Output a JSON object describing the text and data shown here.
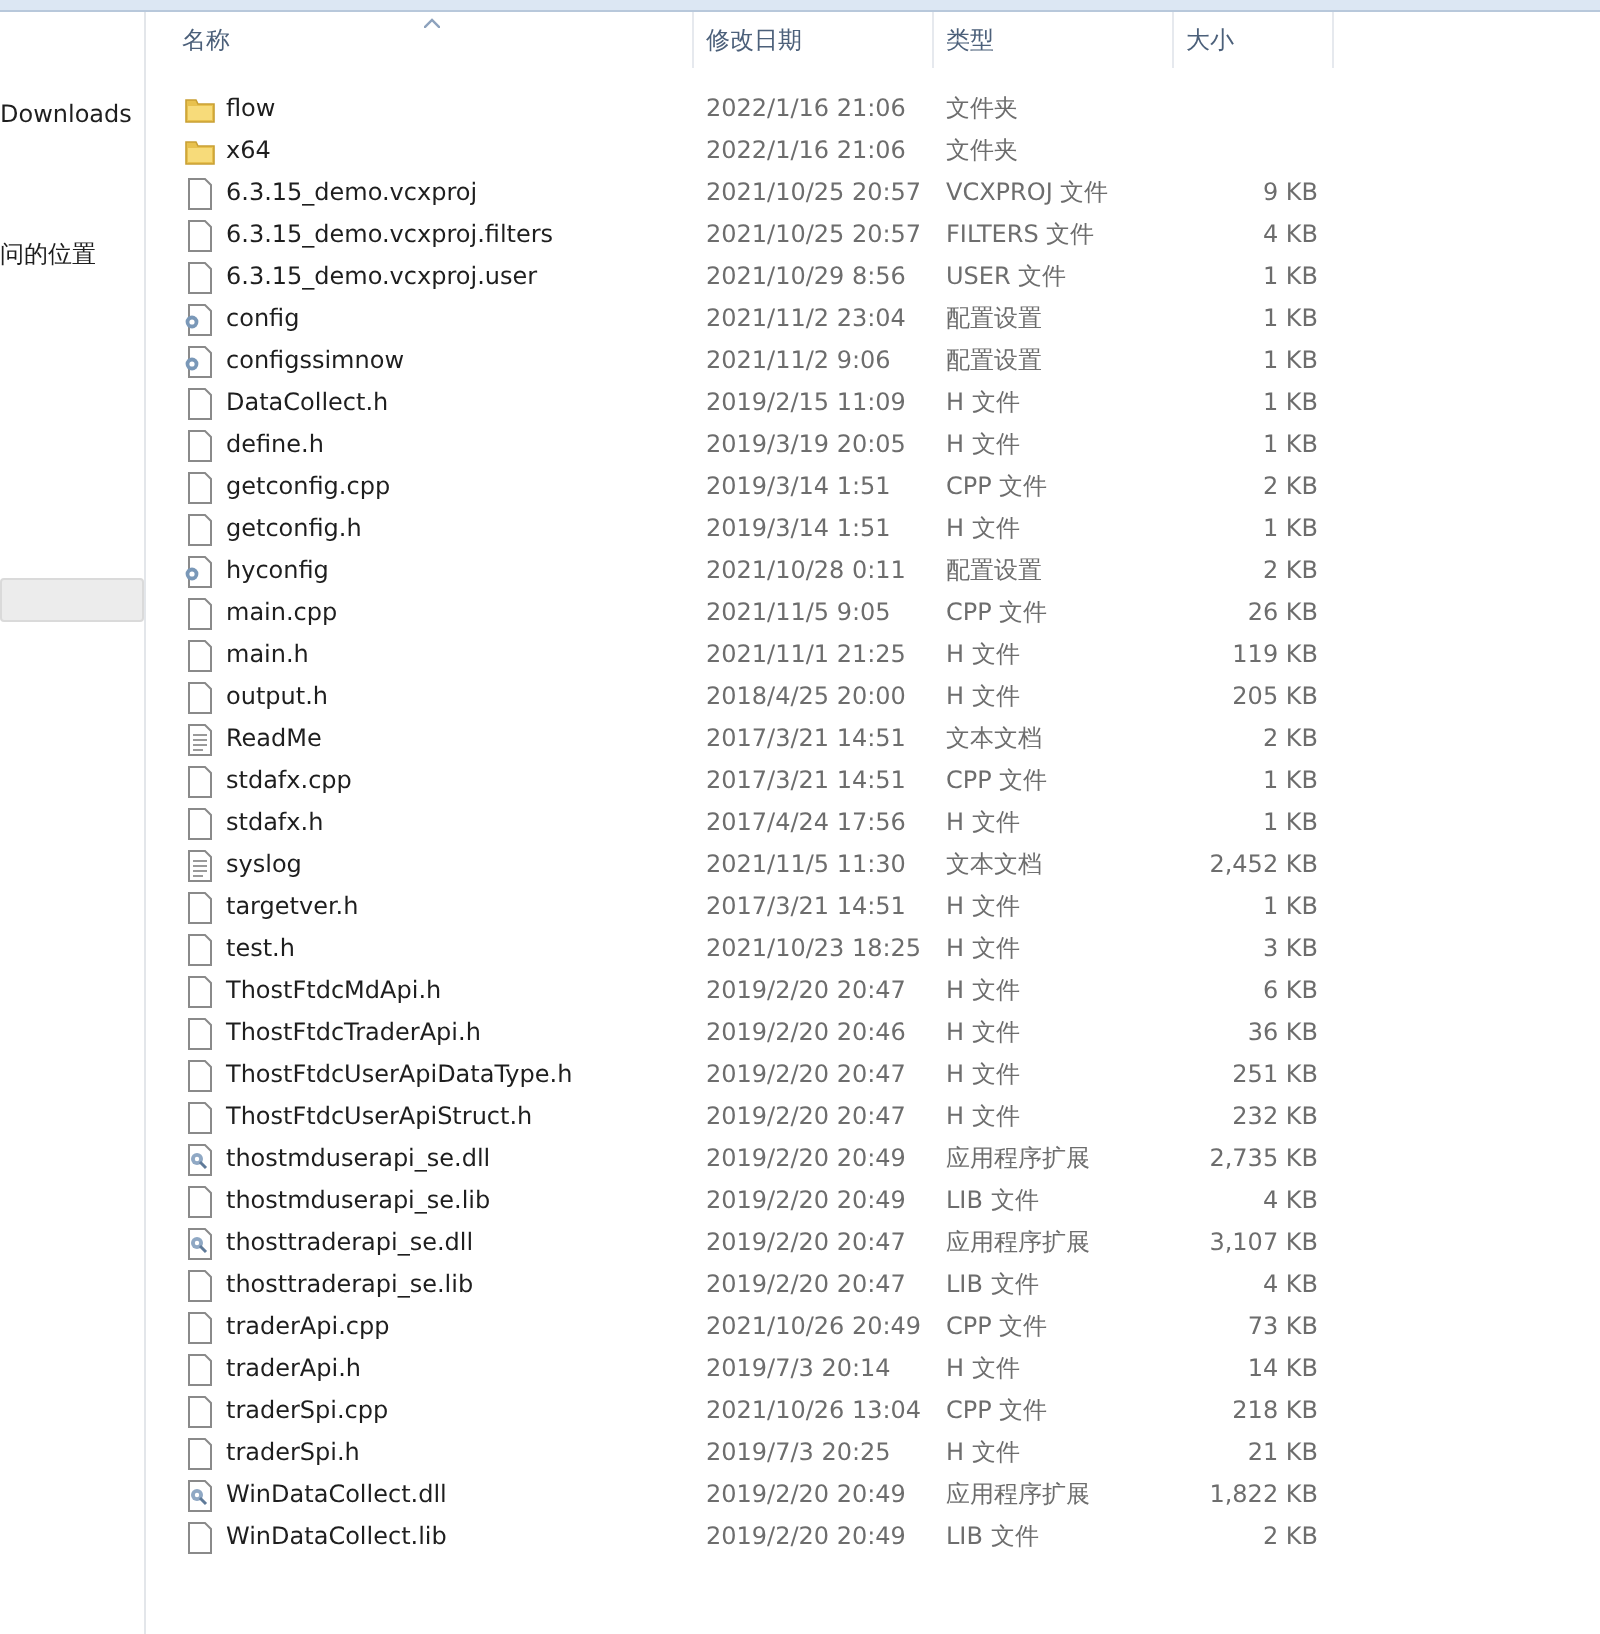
{
  "sidebar": {
    "items": [
      {
        "label": "Downloads",
        "selected": false
      },
      {
        "label": "问的位置",
        "selected": false
      },
      {
        "selected": true
      }
    ]
  },
  "table": {
    "columns": [
      {
        "label": "名称",
        "sorted": true
      },
      {
        "label": "修改日期",
        "sorted": false
      },
      {
        "label": "类型",
        "sorted": false
      },
      {
        "label": "大小",
        "sorted": false
      }
    ],
    "rows": [
      {
        "kind": "folder",
        "name": "flow",
        "date": "2022/1/16 21:06",
        "type": "文件夹",
        "size": ""
      },
      {
        "kind": "folder",
        "name": "x64",
        "date": "2022/1/16 21:06",
        "type": "文件夹",
        "size": ""
      },
      {
        "kind": "file",
        "name": "6.3.15_demo.vcxproj",
        "date": "2021/10/25 20:57",
        "type": "VCXPROJ 文件",
        "size": "9 KB"
      },
      {
        "kind": "file",
        "name": "6.3.15_demo.vcxproj.filters",
        "date": "2021/10/25 20:57",
        "type": "FILTERS 文件",
        "size": "4 KB"
      },
      {
        "kind": "file",
        "name": "6.3.15_demo.vcxproj.user",
        "date": "2021/10/29 8:56",
        "type": "USER 文件",
        "size": "1 KB"
      },
      {
        "kind": "config",
        "name": "config",
        "date": "2021/11/2 23:04",
        "type": "配置设置",
        "size": "1 KB"
      },
      {
        "kind": "config",
        "name": "configssimnow",
        "date": "2021/11/2 9:06",
        "type": "配置设置",
        "size": "1 KB"
      },
      {
        "kind": "file",
        "name": "DataCollect.h",
        "date": "2019/2/15 11:09",
        "type": "H 文件",
        "size": "1 KB"
      },
      {
        "kind": "file",
        "name": "define.h",
        "date": "2019/3/19 20:05",
        "type": "H 文件",
        "size": "1 KB"
      },
      {
        "kind": "file",
        "name": "getconfig.cpp",
        "date": "2019/3/14 1:51",
        "type": "CPP 文件",
        "size": "2 KB"
      },
      {
        "kind": "file",
        "name": "getconfig.h",
        "date": "2019/3/14 1:51",
        "type": "H 文件",
        "size": "1 KB"
      },
      {
        "kind": "config",
        "name": "hyconfig",
        "date": "2021/10/28 0:11",
        "type": "配置设置",
        "size": "2 KB"
      },
      {
        "kind": "file",
        "name": "main.cpp",
        "date": "2021/11/5 9:05",
        "type": "CPP 文件",
        "size": "26 KB"
      },
      {
        "kind": "file",
        "name": "main.h",
        "date": "2021/11/1 21:25",
        "type": "H 文件",
        "size": "119 KB"
      },
      {
        "kind": "file",
        "name": "output.h",
        "date": "2018/4/25 20:00",
        "type": "H 文件",
        "size": "205 KB"
      },
      {
        "kind": "text",
        "name": "ReadMe",
        "date": "2017/3/21 14:51",
        "type": "文本文档",
        "size": "2 KB"
      },
      {
        "kind": "file",
        "name": "stdafx.cpp",
        "date": "2017/3/21 14:51",
        "type": "CPP 文件",
        "size": "1 KB"
      },
      {
        "kind": "file",
        "name": "stdafx.h",
        "date": "2017/4/24 17:56",
        "type": "H 文件",
        "size": "1 KB"
      },
      {
        "kind": "text",
        "name": "syslog",
        "date": "2021/11/5 11:30",
        "type": "文本文档",
        "size": "2,452 KB"
      },
      {
        "kind": "file",
        "name": "targetver.h",
        "date": "2017/3/21 14:51",
        "type": "H 文件",
        "size": "1 KB"
      },
      {
        "kind": "file",
        "name": "test.h",
        "date": "2021/10/23 18:25",
        "type": "H 文件",
        "size": "3 KB"
      },
      {
        "kind": "file",
        "name": "ThostFtdcMdApi.h",
        "date": "2019/2/20 20:47",
        "type": "H 文件",
        "size": "6 KB"
      },
      {
        "kind": "file",
        "name": "ThostFtdcTraderApi.h",
        "date": "2019/2/20 20:46",
        "type": "H 文件",
        "size": "36 KB"
      },
      {
        "kind": "file",
        "name": "ThostFtdcUserApiDataType.h",
        "date": "2019/2/20 20:47",
        "type": "H 文件",
        "size": "251 KB"
      },
      {
        "kind": "file",
        "name": "ThostFtdcUserApiStruct.h",
        "date": "2019/2/20 20:47",
        "type": "H 文件",
        "size": "232 KB"
      },
      {
        "kind": "dll",
        "name": "thostmduserapi_se.dll",
        "date": "2019/2/20 20:49",
        "type": "应用程序扩展",
        "size": "2,735 KB"
      },
      {
        "kind": "file",
        "name": "thostmduserapi_se.lib",
        "date": "2019/2/20 20:49",
        "type": "LIB 文件",
        "size": "4 KB"
      },
      {
        "kind": "dll",
        "name": "thosttraderapi_se.dll",
        "date": "2019/2/20 20:47",
        "type": "应用程序扩展",
        "size": "3,107 KB"
      },
      {
        "kind": "file",
        "name": "thosttraderapi_se.lib",
        "date": "2019/2/20 20:47",
        "type": "LIB 文件",
        "size": "4 KB"
      },
      {
        "kind": "file",
        "name": "traderApi.cpp",
        "date": "2021/10/26 20:49",
        "type": "CPP 文件",
        "size": "73 KB"
      },
      {
        "kind": "file",
        "name": "traderApi.h",
        "date": "2019/7/3 20:14",
        "type": "H 文件",
        "size": "14 KB"
      },
      {
        "kind": "file",
        "name": "traderSpi.cpp",
        "date": "2021/10/26 13:04",
        "type": "CPP 文件",
        "size": "218 KB"
      },
      {
        "kind": "file",
        "name": "traderSpi.h",
        "date": "2019/7/3 20:25",
        "type": "H 文件",
        "size": "21 KB"
      },
      {
        "kind": "dll",
        "name": "WinDataCollect.dll",
        "date": "2019/2/20 20:49",
        "type": "应用程序扩展",
        "size": "1,822 KB"
      },
      {
        "kind": "file",
        "name": "WinDataCollect.lib",
        "date": "2019/2/20 20:49",
        "type": "LIB 文件",
        "size": "2 KB"
      }
    ]
  }
}
